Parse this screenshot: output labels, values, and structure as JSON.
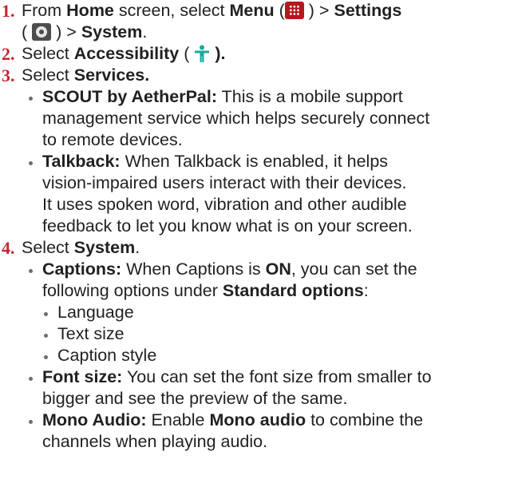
{
  "steps": [
    {
      "number": "1.",
      "parts": {
        "from": "From",
        "home": "Home",
        "screen_select": "screen, select",
        "menu": "Menu",
        "open_paren": "(",
        "close_paren_gt": ") >",
        "settings": "Settings",
        "open_paren2": "(",
        "close_paren_gt2": ") >",
        "system": "System",
        "period": "."
      }
    },
    {
      "number": "2.",
      "parts": {
        "select": "Select",
        "accessibility": "Accessibility",
        "open_paren": "(",
        "close_paren_period": ")."
      }
    },
    {
      "number": "3.",
      "parts": {
        "select": "Select",
        "services": "Services."
      },
      "bullets": [
        {
          "term": "SCOUT by AetherPal:",
          "lines": [
            "This is a mobile support",
            "management service which helps securely connect",
            "to remote devices."
          ]
        },
        {
          "term": "Talkback:",
          "lines": [
            "When Talkback is enabled, it helps",
            "vision-impaired users interact with their devices.",
            "It uses spoken word, vibration and other audible",
            "feedback to let you know what is on your screen."
          ]
        }
      ]
    },
    {
      "number": "4.",
      "parts": {
        "select": "Select",
        "system": "System",
        "period": "."
      },
      "bullets": [
        {
          "term": "Captions:",
          "line1_a": "When Captions is",
          "line1_on": "ON",
          "line1_b": ", you can set the",
          "line2_a": "following options under",
          "line2_bold": "Standard options",
          "line2_b": ":",
          "subitems": [
            "Language",
            "Text size",
            "Caption style"
          ]
        },
        {
          "term": "Font size:",
          "lines": [
            "You can set the font size from smaller to",
            "bigger and see the preview of the same."
          ]
        },
        {
          "term": "Mono Audio:",
          "line1_a": "Enable",
          "line1_bold": "Mono audio",
          "line1_b": "to combine the",
          "line2": "channels when playing audio."
        }
      ]
    }
  ],
  "icons": {
    "menu": "menu-grid-icon",
    "settings": "gear-icon",
    "accessibility": "accessibility-icon"
  },
  "colors": {
    "step_number": "#c4262e",
    "text": "#231f20",
    "menu_icon_bg": "#b5171e",
    "settings_icon_bg": "#4d4d4d",
    "accessibility_icon": "#1aa89a",
    "bullet": "#6d6e71"
  }
}
